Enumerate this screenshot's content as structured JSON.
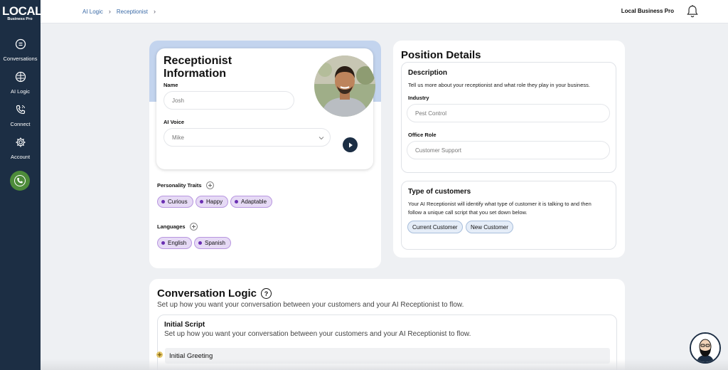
{
  "app": {
    "logo_main": "LOCAL",
    "logo_sub": "Business Pro"
  },
  "sidebar": {
    "items": [
      {
        "label": "Conversations",
        "icon": "chat-icon"
      },
      {
        "label": "AI Logic",
        "icon": "brain-icon"
      },
      {
        "label": "Connect",
        "icon": "phone-icon"
      },
      {
        "label": "Account",
        "icon": "gear-icon"
      }
    ],
    "call_icon": "phone-call-icon"
  },
  "topbar": {
    "breadcrumb": [
      "AI Logic",
      "Receptionist"
    ],
    "business_name": "Local Business Pro",
    "bell_icon": "bell-icon"
  },
  "receptionist": {
    "title": "Receptionist Information",
    "name_label": "Name",
    "name_value": "Josh",
    "voice_label": "AI Voice",
    "voice_value": "Mike",
    "traits_label": "Personality Traits",
    "traits": [
      "Curious",
      "Happy",
      "Adaptable"
    ],
    "languages_label": "Languages",
    "languages": [
      "English",
      "Spanish"
    ]
  },
  "position": {
    "title": "Position Details",
    "description_title": "Description",
    "description_text": "Tell us more about your receptionist and what role they play in your business.",
    "industry_label": "Industry",
    "industry_placeholder": "Pest Control",
    "office_role_label": "Office Role",
    "office_role_placeholder": "Customer Support",
    "customers_title": "Type of customers",
    "customers_text_1": "Your AI Receptionist will identify what type of customer it is talking to and then",
    "customers_text_2": "follow a unique call script that you set down below.",
    "customer_types": [
      "Current Customer",
      "New Customer"
    ]
  },
  "conversation": {
    "title": "Conversation Logic",
    "help": "?",
    "description": "Set up how you want your conversation between your customers and your AI Receptionist to flow.",
    "script_title": "Initial Script",
    "script_description": "Set up how you want your conversation between your customers and your AI Receptionist to flow.",
    "greeting_label": "Initial Greeting"
  },
  "colors": {
    "sidebar": "#1c2e44",
    "accent_blue": "#c3d4ee",
    "chip_purple": "#e6daf5",
    "call_green": "#4d8b3a"
  }
}
